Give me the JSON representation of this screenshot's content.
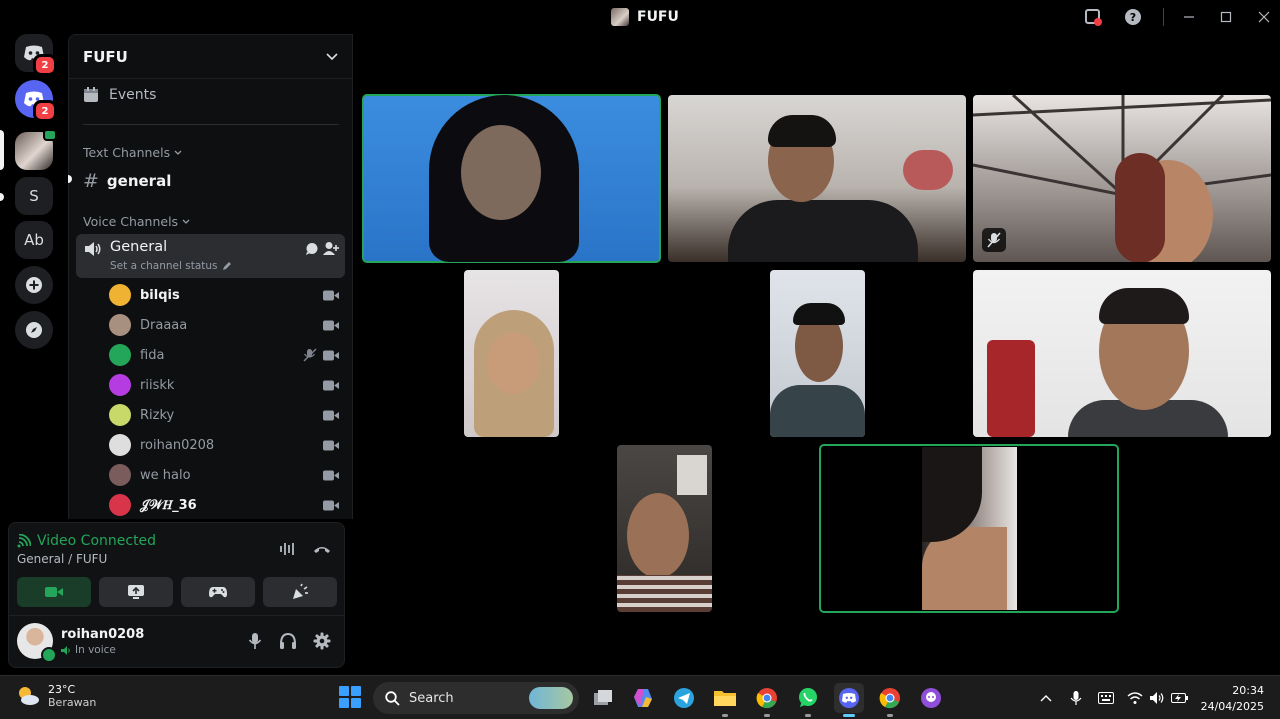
{
  "window": {
    "title": "FUFU"
  },
  "rail": {
    "dm_badge": "2",
    "discord_badge": "2",
    "servers": [
      "S",
      "Ab"
    ]
  },
  "sidebar": {
    "guild_name": "FUFU",
    "events_label": "Events",
    "text_category": "Text Channels",
    "text_channel": "general",
    "voice_category": "Voice Channels",
    "voice_channel": "General",
    "voice_status_placeholder": "Set a channel status",
    "members": [
      {
        "name": "bilqis",
        "bold": true,
        "avatar_color": "#f0b232"
      },
      {
        "name": "Draaaa",
        "bold": false,
        "avatar_color": "#a89080"
      },
      {
        "name": "fida",
        "bold": false,
        "avatar_color": "#23a55a"
      },
      {
        "name": "riiskk",
        "bold": false,
        "avatar_color": "#b43ce0"
      },
      {
        "name": "Rizky",
        "bold": false,
        "avatar_color": "#c8d96a"
      },
      {
        "name": "roihan0208",
        "bold": false,
        "avatar_color": "#dedede"
      },
      {
        "name": "we halo",
        "bold": false,
        "avatar_color": "#7a5c5c"
      },
      {
        "name": "𝒥𝒲𝐻_36",
        "bold": true,
        "avatar_color": "#d8344a"
      }
    ]
  },
  "voice_panel": {
    "status": "Video Connected",
    "location": "General / FUFU",
    "user_name": "roihan0208",
    "user_state": "In voice"
  },
  "taskbar": {
    "temperature": "23°C",
    "weather": "Berawan",
    "search_placeholder": "Search",
    "time": "20:34",
    "date": "24/04/2025"
  },
  "colors": {
    "accent_green": "#23a55a",
    "blurple": "#5865f2",
    "badge_red": "#f23f43"
  }
}
